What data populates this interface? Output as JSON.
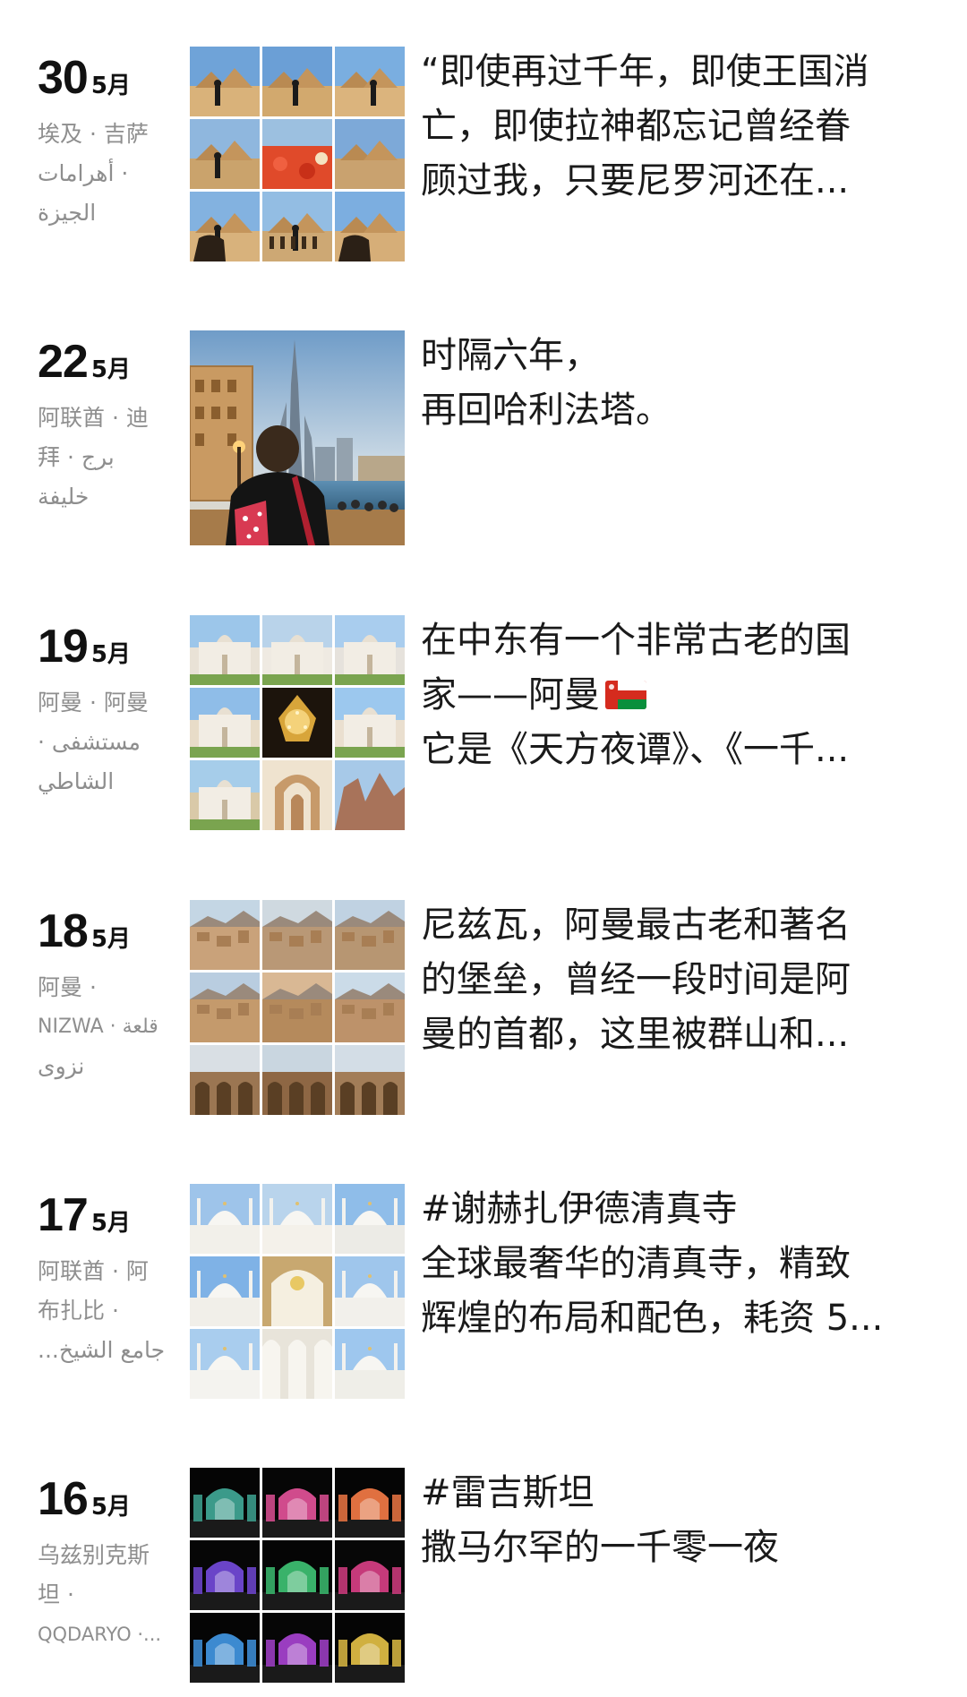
{
  "entries": [
    {
      "day": "30",
      "month": "5月",
      "location_lines": [
        "埃及 · 吉萨",
        "أهرامات ·",
        "الجيزة"
      ],
      "caption_lines": [
        "“即使再过千年，即使王国消",
        "亡，即使拉神都忘记曾经眷",
        "顾过我，只要尼罗河还在..."
      ],
      "thumbnail": "pyramids-grid",
      "tile_palettes": [
        [
          "#6fa3d8",
          "#d9b27a"
        ],
        [
          "#6b9fd6",
          "#d2a96e"
        ],
        [
          "#7aaee0",
          "#dbb47d"
        ],
        [
          "#8fb7de",
          "#caa36c"
        ],
        [
          "#9cc0e0",
          "#d5462b"
        ],
        [
          "#7da9d8",
          "#c9a26f"
        ],
        [
          "#83b2e0",
          "#d8b27c"
        ],
        [
          "#93bde3",
          "#cda874"
        ],
        [
          "#7caee0",
          "#d6ae78"
        ]
      ]
    },
    {
      "day": "22",
      "month": "5月",
      "location_lines": [
        "阿联酋 · 迪",
        "拜 · برج",
        "خليفة"
      ],
      "caption_lines": [
        "时隔六年，",
        "再回哈利法塔。"
      ],
      "thumbnail": "burj-khalifa-photo",
      "tile_palettes": []
    },
    {
      "day": "19",
      "month": "5月",
      "location_lines": [
        "阿曼 · 阿曼",
        "مستشفى ·",
        "الشاطي"
      ],
      "caption_lines": [
        "在中东有一个非常古老的国",
        "家——阿曼",
        "它是《天方夜谭》、《一千..."
      ],
      "flag_line": 1,
      "thumbnail": "oman-grid",
      "tile_palettes": [
        [
          "#9cc6ea",
          "#e9e2d6"
        ],
        [
          "#b9d3ea",
          "#efeae2"
        ],
        [
          "#a9cdee",
          "#e6e2dc"
        ],
        [
          "#8fbde8",
          "#e8dcc8"
        ],
        [
          "#1c140c",
          "#d8a53a"
        ],
        [
          "#9cc8ee",
          "#eadfcf"
        ],
        [
          "#a6cdea",
          "#d9c9a8"
        ],
        [
          "#caa27a",
          "#efe3cf"
        ],
        [
          "#a7c9e8",
          "#a8735a"
        ]
      ]
    },
    {
      "day": "18",
      "month": "5月",
      "location_lines": [
        "阿曼 ·",
        "NIZWA · قلعة",
        "نزوى"
      ],
      "caption_lines": [
        "尼兹瓦，阿曼最古老和著名",
        "的堡垒，曾经一段时间是阿",
        "曼的首都，这里被群山和..."
      ],
      "thumbnail": "nizwa-grid",
      "tile_palettes": [
        [
          "#c4d6e4",
          "#c9a27a"
        ],
        [
          "#cfd9e0",
          "#b99876"
        ],
        [
          "#c0d2e2",
          "#b79672"
        ],
        [
          "#b9cde0",
          "#c49a6c"
        ],
        [
          "#d9b894",
          "#b58a5c"
        ],
        [
          "#cbdbe8",
          "#bd926a"
        ],
        [
          "#d9dfe4",
          "#9b7652"
        ],
        [
          "#c9d6e0",
          "#8e6744"
        ],
        [
          "#d3dde6",
          "#a27d58"
        ]
      ]
    },
    {
      "day": "17",
      "month": "5月",
      "location_lines": [
        "阿联酋 · 阿",
        "布扎比 ·",
        "جامع الشيخ..."
      ],
      "caption_lines": [
        "#谢赫扎伊德清真寺",
        "全球最奢华的清真寺，精致",
        "辉煌的布局和配色，耗资 5..."
      ],
      "thumbnail": "grand-mosque-grid",
      "tile_palettes": [
        [
          "#9ec4ea",
          "#f2f0ea"
        ],
        [
          "#b9d4ec",
          "#f4f1ea"
        ],
        [
          "#8fbde9",
          "#ecebe6"
        ],
        [
          "#7fb2e6",
          "#f1efe9"
        ],
        [
          "#d9c08a",
          "#f5efe0"
        ],
        [
          "#9fc6ec",
          "#f2f0eb"
        ],
        [
          "#a9cdee",
          "#f4f3ef"
        ],
        [
          "#e8e4da",
          "#f7f5ef"
        ],
        [
          "#9ec7ee",
          "#efeee8"
        ]
      ]
    },
    {
      "day": "16",
      "month": "5月",
      "location_lines": [
        "乌兹别克斯",
        "坦 ·",
        "QQDARYO ·..."
      ],
      "caption_lines": [
        "#雷吉斯坦",
        "撒马尔罕的一千零一夜"
      ],
      "thumbnail": "registan-night-grid",
      "tile_palettes": [
        [
          "#050505",
          "#3b9a8a"
        ],
        [
          "#060606",
          "#d04b8c"
        ],
        [
          "#050505",
          "#e07040"
        ],
        [
          "#060606",
          "#6a44c8"
        ],
        [
          "#050505",
          "#39b26a"
        ],
        [
          "#070707",
          "#c63a7a"
        ],
        [
          "#050505",
          "#3c8ad0"
        ],
        [
          "#060606",
          "#9a3dc0"
        ],
        [
          "#050505",
          "#d0b040"
        ]
      ]
    }
  ],
  "flag_colors": {
    "white": "#ffffff",
    "red": "#d52b1e",
    "green": "#0a8f3c"
  }
}
